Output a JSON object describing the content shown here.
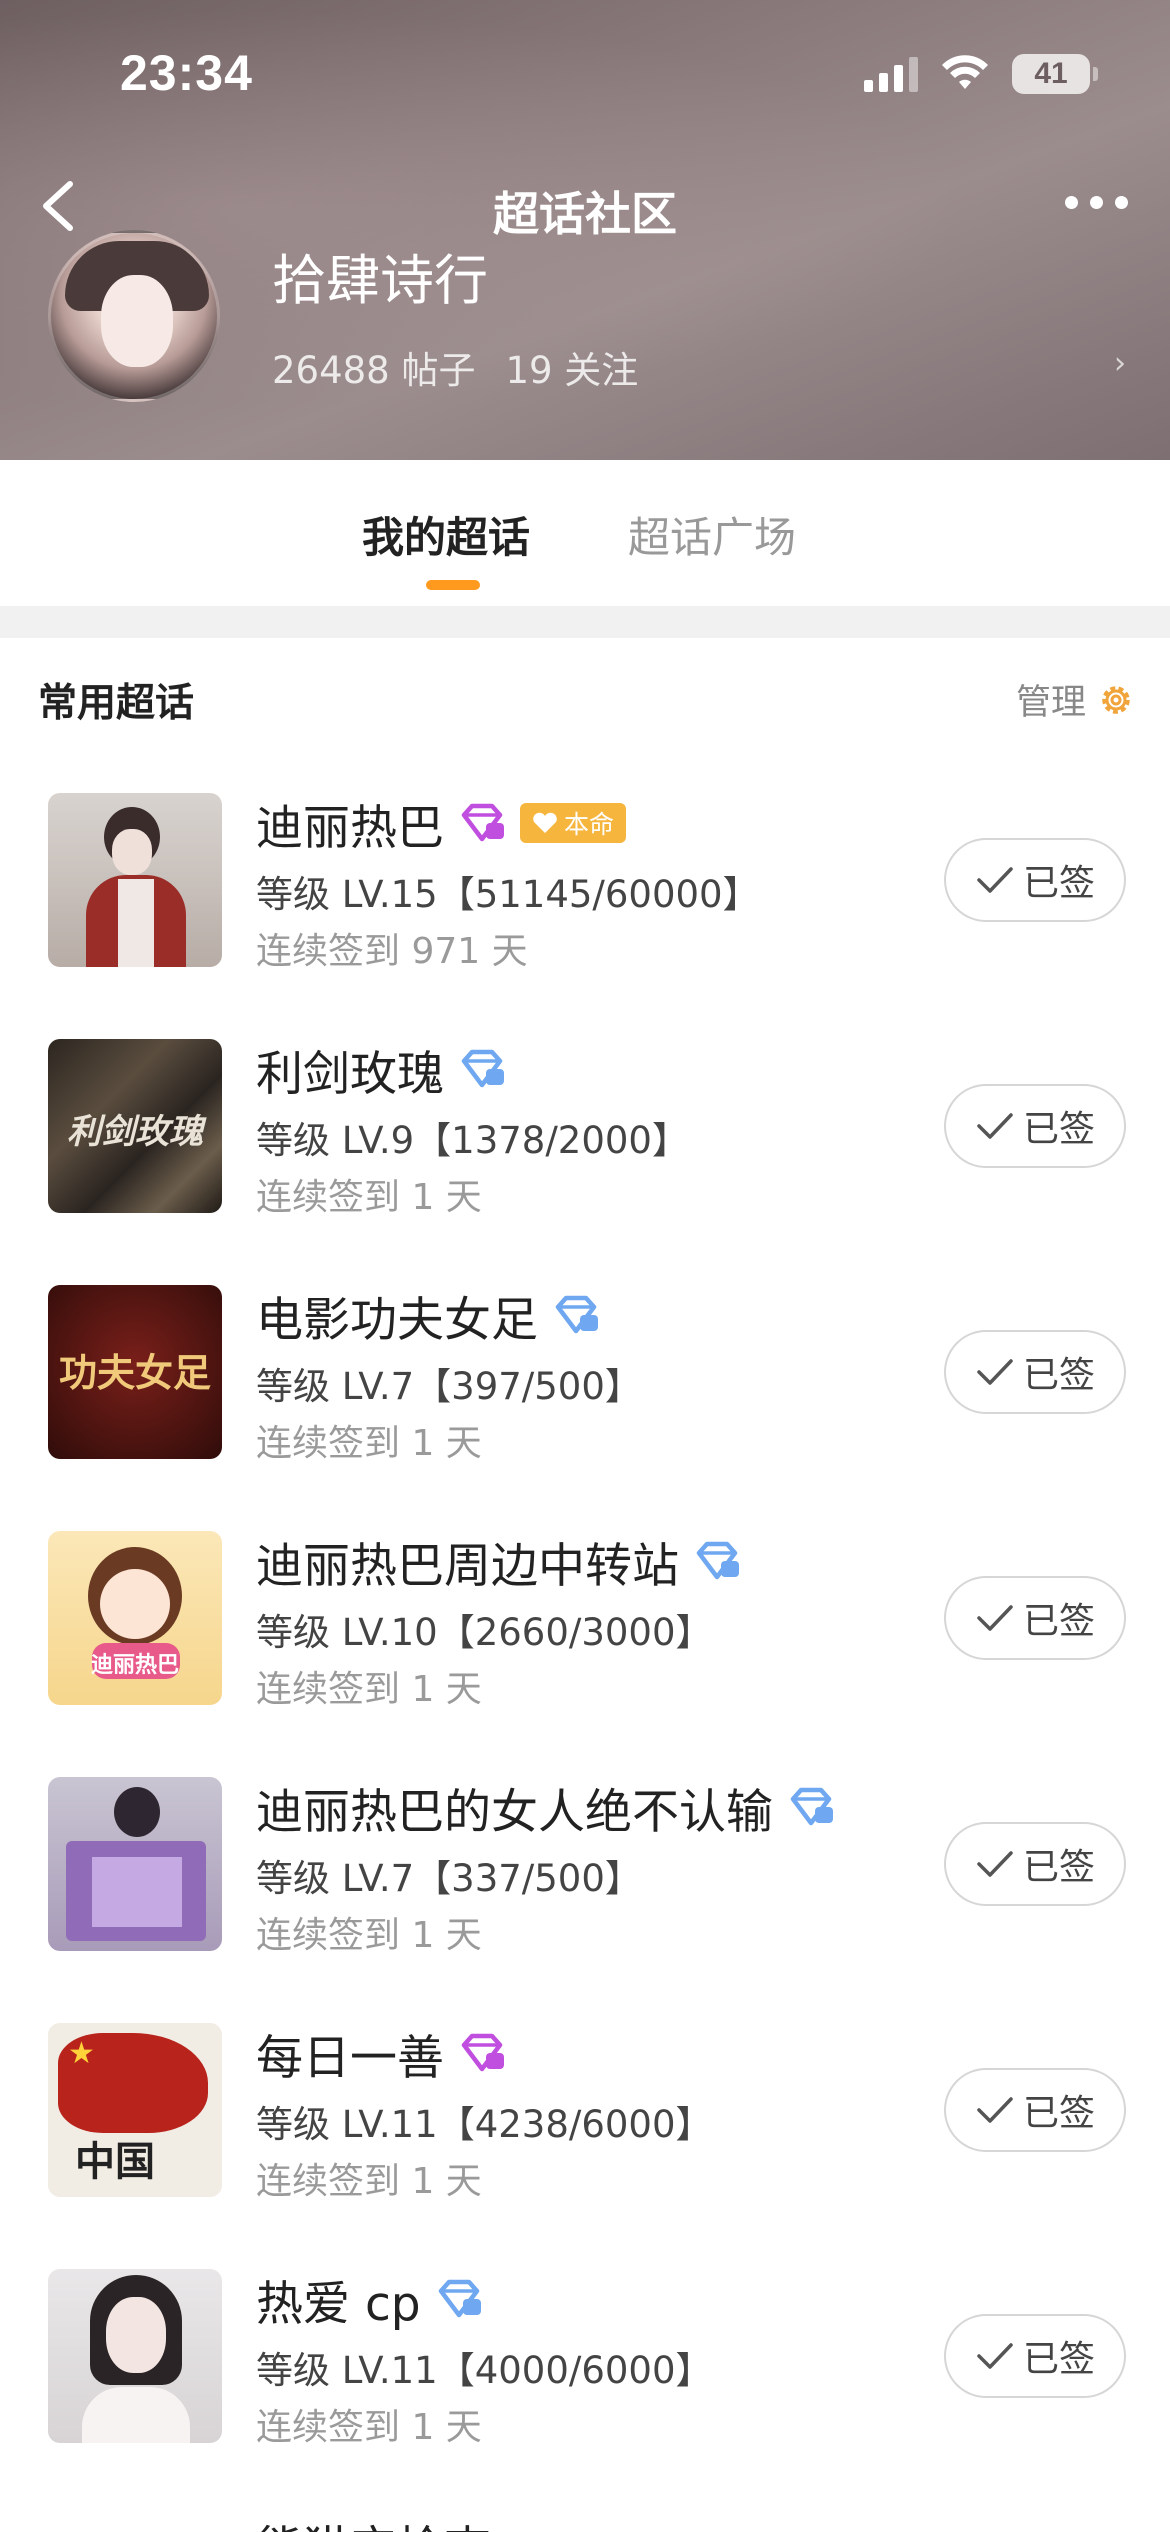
{
  "status": {
    "time": "23:34",
    "battery": "41"
  },
  "nav": {
    "title": "超话社区"
  },
  "profile": {
    "name": "拾肆诗行",
    "posts": "26488 帖子",
    "follows": "19 关注"
  },
  "tabs": [
    {
      "label": "我的超话",
      "active": true
    },
    {
      "label": "超话广场",
      "active": false
    }
  ],
  "section": {
    "title": "常用超话",
    "manage_label": "管理"
  },
  "items": [
    {
      "name": "迪丽热巴",
      "gem": "purple",
      "badge": "本命",
      "level": "等级 LV.15【51145/60000】",
      "streak": "连续签到 971 天",
      "sign": "已签",
      "thumb": "photo-red-coat"
    },
    {
      "name": "利剑玫瑰",
      "gem": "blue",
      "level": "等级 LV.9【1378/2000】",
      "streak": "连续签到 1 天",
      "sign": "已签",
      "thumb": "poster-dark",
      "thumb_text": "利剑玫瑰"
    },
    {
      "name": "电影功夫女足",
      "gem": "blue",
      "level": "等级 LV.7【397/500】",
      "streak": "连续签到 1 天",
      "sign": "已签",
      "thumb": "poster-maroon",
      "thumb_text": "功夫女足"
    },
    {
      "name": "迪丽热巴周边中转站",
      "gem": "blue",
      "level": "等级 LV.10【2660/3000】",
      "streak": "连续签到 1 天",
      "sign": "已签",
      "thumb": "cartoon",
      "thumb_text": "迪丽热巴"
    },
    {
      "name": "迪丽热巴的女人绝不认输",
      "gem": "blue",
      "level": "等级 LV.7【337/500】",
      "streak": "连续签到 1 天",
      "sign": "已签",
      "thumb": "photo-purple"
    },
    {
      "name": "每日一善",
      "gem": "purple",
      "level": "等级 LV.11【4238/6000】",
      "streak": "连续签到 1 天",
      "sign": "已签",
      "thumb": "china-map",
      "thumb_text": "中国"
    },
    {
      "name": "热爱 cp",
      "gem": "blue",
      "level": "等级 LV.11【4000/6000】",
      "streak": "连续签到 1 天",
      "sign": "已签",
      "thumb": "portrait"
    }
  ],
  "partial_item": {
    "name": "熊猫宝检查"
  },
  "colors": {
    "accent": "#ff9a1e",
    "gem_purple": "#c04fe0",
    "gem_blue": "#6fa8f0",
    "badge": "#f6b63e"
  }
}
